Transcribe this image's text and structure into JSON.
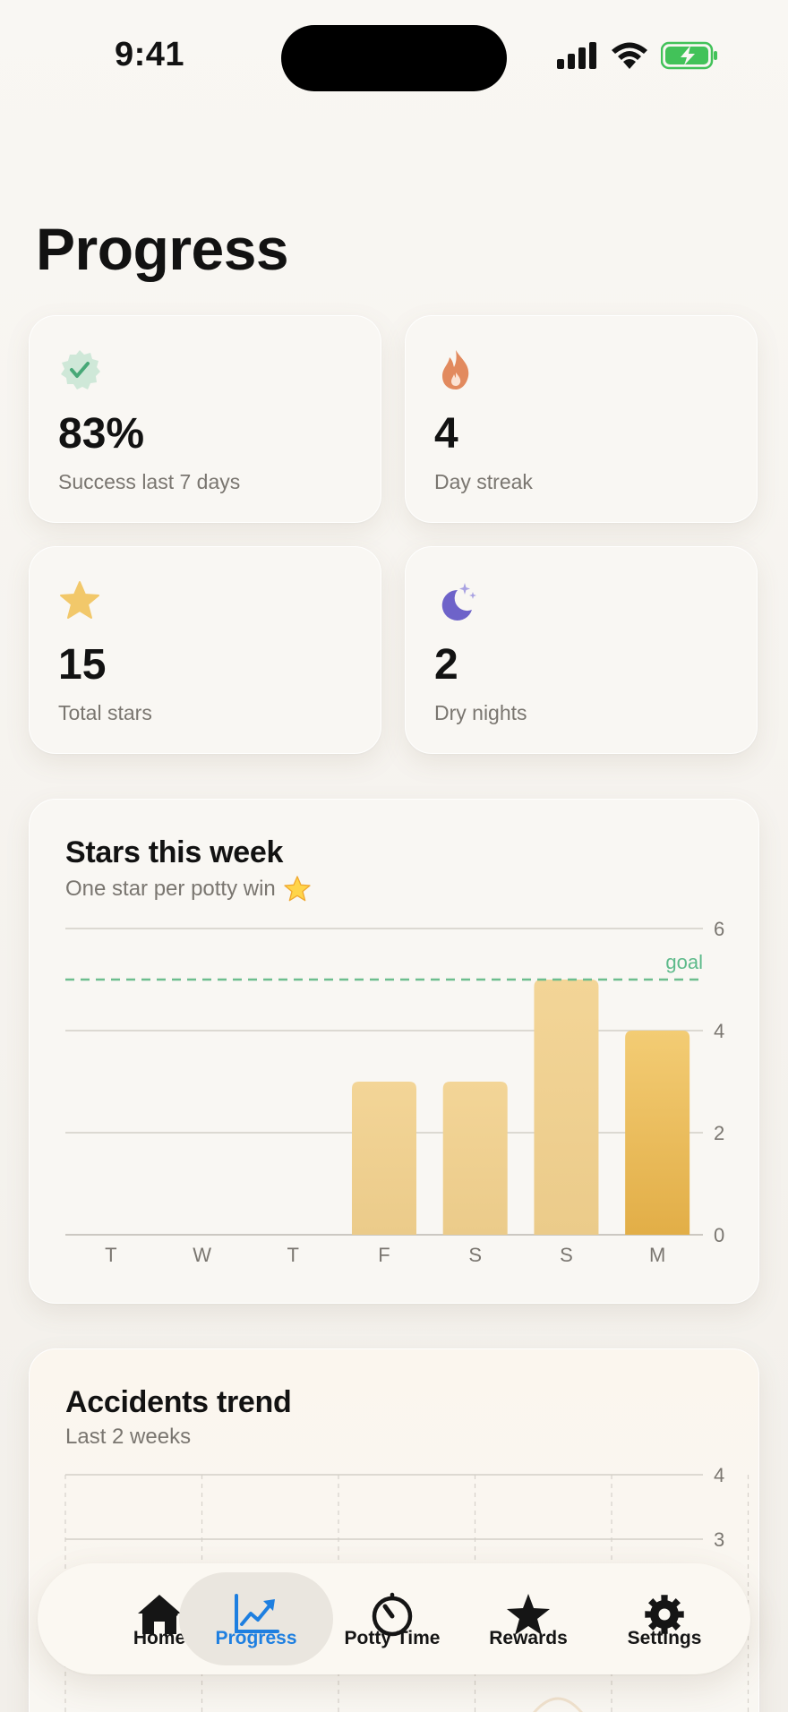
{
  "status": {
    "time": "9:41"
  },
  "page": {
    "title": "Progress"
  },
  "stats": [
    {
      "value": "83%",
      "label": "Success last 7 days",
      "icon": "badge-check-icon"
    },
    {
      "value": "4",
      "label": "Day streak",
      "icon": "flame-icon"
    },
    {
      "value": "15",
      "label": "Total stars",
      "icon": "star-icon"
    },
    {
      "value": "2",
      "label": "Dry nights",
      "icon": "moon-stars-icon"
    }
  ],
  "colors": {
    "accent": "#1E7FE0",
    "green": "#5DBA8A",
    "orange": "#E28A5E",
    "gold": "#F2C86A",
    "purple": "#6E63C9",
    "battery": "#42C259"
  },
  "stars_chart": {
    "title": "Stars this week",
    "subtitle": "One star per potty win",
    "goal_label": "goal"
  },
  "accidents_chart": {
    "title": "Accidents trend",
    "subtitle": "Last 2 weeks"
  },
  "chart_data": [
    {
      "type": "bar",
      "title": "Stars this week",
      "subtitle": "One star per potty win",
      "categories": [
        "T",
        "W",
        "T",
        "F",
        "S",
        "S",
        "M"
      ],
      "values": [
        0,
        0,
        0,
        3,
        3,
        5,
        4
      ],
      "ylim": [
        0,
        6
      ],
      "yticks": [
        0,
        2,
        4,
        6
      ],
      "goal": 5,
      "grid": true
    },
    {
      "type": "line",
      "title": "Accidents trend",
      "subtitle": "Last 2 weeks",
      "ylim": [
        0,
        4
      ],
      "yticks": [
        3,
        4
      ],
      "grid": true
    }
  ],
  "tabs": [
    {
      "label": "Home",
      "icon": "house-icon",
      "active": false
    },
    {
      "label": "Progress",
      "icon": "chart-trend-icon",
      "active": true
    },
    {
      "label": "Potty Time",
      "icon": "timer-icon",
      "active": false
    },
    {
      "label": "Rewards",
      "icon": "star-icon",
      "active": false
    },
    {
      "label": "Settings",
      "icon": "gear-icon",
      "active": false
    }
  ]
}
